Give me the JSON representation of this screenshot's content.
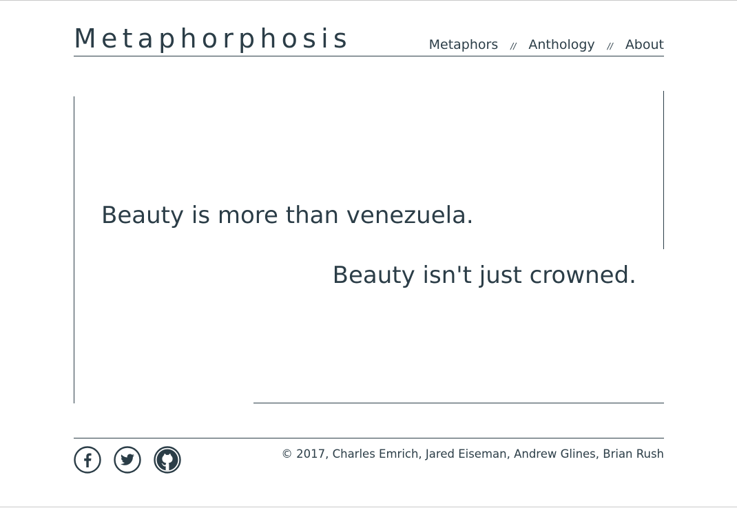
{
  "header": {
    "logo": "Metaphorphosis",
    "nav": [
      {
        "label": "Metaphors"
      },
      {
        "label": "Anthology"
      },
      {
        "label": "About"
      }
    ],
    "separator": "//"
  },
  "main": {
    "metaphors": [
      "Beauty is more than venezuela.",
      "Beauty isn't just crowned."
    ]
  },
  "footer": {
    "social": [
      {
        "icon": "facebook-icon"
      },
      {
        "icon": "twitter-icon"
      },
      {
        "icon": "github-icon"
      }
    ],
    "copyright": "© 2017, Charles Emrich, Jared Eiseman, Andrew Glines, Brian Rush"
  },
  "colors": {
    "text": "#2b3d47",
    "background": "#ffffff"
  }
}
